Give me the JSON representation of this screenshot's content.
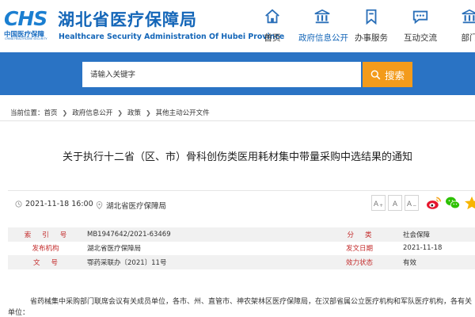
{
  "site": {
    "logo_mark": "CHS",
    "logo_cn": "中国医疗保障",
    "logo_en": "CHINA HEALTHCARE SECURITY",
    "title": "湖北省医疗保障局",
    "subtitle": "Healthcare Security Administration Of Hubei Province"
  },
  "nav": [
    {
      "label": "首页",
      "icon": "home-icon"
    },
    {
      "label": "政府信息公开",
      "icon": "building-icon"
    },
    {
      "label": "办事服务",
      "icon": "bookmark-icon"
    },
    {
      "label": "互动交流",
      "icon": "chat-icon"
    },
    {
      "label": "部门",
      "icon": "building-icon"
    }
  ],
  "search": {
    "placeholder": "请输入关键字",
    "button_label": "搜索"
  },
  "breadcrumb": {
    "prefix": "当前位置：",
    "items": [
      "首页",
      "政府信息公开",
      "政策",
      "其他主动公开文件"
    ]
  },
  "article": {
    "title": "关于执行十二省（区、市）骨科创伤类医用耗材集中带量采购中选结果的通知",
    "date": "2021-11-18 16:00",
    "publisher": "湖北省医疗保障局",
    "font_buttons": [
      "A",
      "A",
      "A"
    ]
  },
  "info": {
    "rows": [
      {
        "l1": "索引号",
        "v1": "MB1947642/2021-63469",
        "l2": "分类",
        "v2": "社会保障"
      },
      {
        "l1": "发布机构",
        "v1": "湖北省医疗保障局",
        "l2": "发文日期",
        "v2": "2021-11-18"
      },
      {
        "l1": "文号",
        "v1": "鄂药采联办〔2021〕11号",
        "l2": "效力状态",
        "v2": "有效"
      }
    ]
  },
  "body": {
    "line1": "省药械集中采购部门联席会议有关成员单位，各市、州、直管市、神农架林区医疗保障局，在汉部省属公立医疗机构和军队医疗机构，各有关",
    "line2": "单位："
  },
  "colors": {
    "brand_blue": "#1466b8",
    "search_band": "#2a73c4",
    "search_button": "#f39b1b",
    "label_red": "#c32a2a"
  }
}
